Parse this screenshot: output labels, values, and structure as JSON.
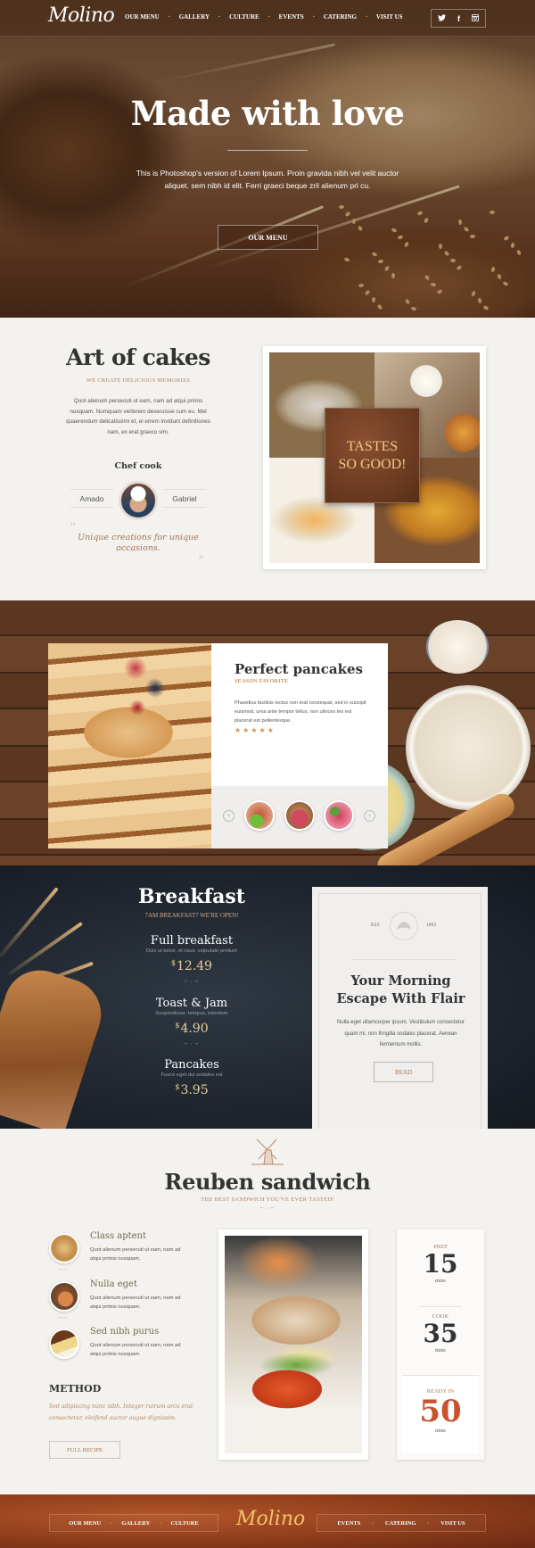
{
  "header": {
    "logo": "Molino",
    "nav": [
      "OUR MENU",
      "GALLERY",
      "CULTURE",
      "EVENTS",
      "CATERING",
      "VISIT US"
    ],
    "social": [
      {
        "name": "twitter-icon",
        "glyph": "𝕥"
      },
      {
        "name": "facebook-icon",
        "glyph": "f"
      },
      {
        "name": "instagram-icon",
        "glyph": "◙"
      }
    ]
  },
  "hero": {
    "title": "Made with love",
    "text": "This is Photoshop's version  of Lorem Ipsum. Proin gravida nibh vel velit auctor aliquet. sem nibh id elit. Ferri graeci beque zril alienum pri cu.",
    "button": "OUR MENU"
  },
  "art": {
    "title": "Art of cakes",
    "subtitle": "WE CREATE DELICIOUS MEMORIES",
    "text": "Quot alienum persecuti ut eam, nam ad atqui primis nusquam. Numquam verterem deseruisse cum eu. Mel quaerendum delicatissimi et, ei errem invidunt definitiones nam, ex erat graeco vim.",
    "chef_title": "Chef cook",
    "chef_left": "Amado",
    "chef_right": "Gabriel",
    "quote": "Unique creations for unique occasions.",
    "collage_badge_line1": "TASTES",
    "collage_badge_line2": "SO GOOD!"
  },
  "pancakes": {
    "title": "Perfect pancakes",
    "subtitle": "SEASON FAVORITE",
    "text": "Phasellus facilisis lectus non erat consequat, sed in suscipit euismod, urna ante tempor tellus, non ultrices leo est placerat est pellentesque.",
    "rating": 5,
    "stars": "★★★★★",
    "prev": "‹",
    "next": "›"
  },
  "breakfast": {
    "title": "Breakfast",
    "subtitle": "7AM BREAKFAST? WE'RE OPEN!",
    "items": [
      {
        "name": "Full breakfast",
        "desc": "Duis ut tortor, et risus, vulputate pretium",
        "currency": "$",
        "price": "12.49"
      },
      {
        "name": "Toast & Jam",
        "desc": "Suspendisse, tempus, interdum",
        "currency": "$",
        "price": "4.90"
      },
      {
        "name": "Pancakes",
        "desc": "Fusce eget dui sodales est",
        "currency": "$",
        "price": "3.95"
      }
    ],
    "divider": "⊷ • ⊶"
  },
  "escape": {
    "est_label": "EST.",
    "est_year": "1893",
    "title_line1": "Your Morning",
    "title_line2": "Escape With Flair",
    "text": "Nulla eget ullamcorper ipsum. Vestibulum consectetur quam mi, non fringilla sodales placerat. Aenean fermentum mollis.",
    "button": "READ"
  },
  "reuben": {
    "title": "Reuben sandwich",
    "subtitle": "THE BEST SANDWICH YOU'VE EVER TASTED!",
    "divider": "⊷ • ⊶",
    "features": [
      {
        "title": "Class aptent",
        "text": "Quot alienum persecuti ut eam, nam ad atqui primis nusquam."
      },
      {
        "title": "Nulla eget",
        "text": "Quot alienum persecuti ut eam, nam ad atqui primis nusquam."
      },
      {
        "title": "Sed nibh purus",
        "text": "Quot alienum persecuti ut eam, nam ad atqui primis nusquam."
      }
    ],
    "method_title": "METHOD",
    "method_text": "Sed adipiscing nunc nibh. Integer rutrum arcu erat consectetur, eleifend auctor augue dignissim.",
    "button": "FULL RECIPE",
    "times": [
      {
        "label": "PREP",
        "value": "15",
        "unit": "mins"
      },
      {
        "label": "COOK",
        "value": "35",
        "unit": "mins"
      },
      {
        "label": "READY IN",
        "value": "50",
        "unit": "mins"
      }
    ],
    "accent_color": "#c9532d"
  },
  "footer": {
    "logo": "Molino",
    "nav_left": [
      "OUR MENU",
      "GALLERY",
      "CULTURE"
    ],
    "nav_right": [
      "EVENTS",
      "CATERING",
      "VISIT US"
    ]
  }
}
